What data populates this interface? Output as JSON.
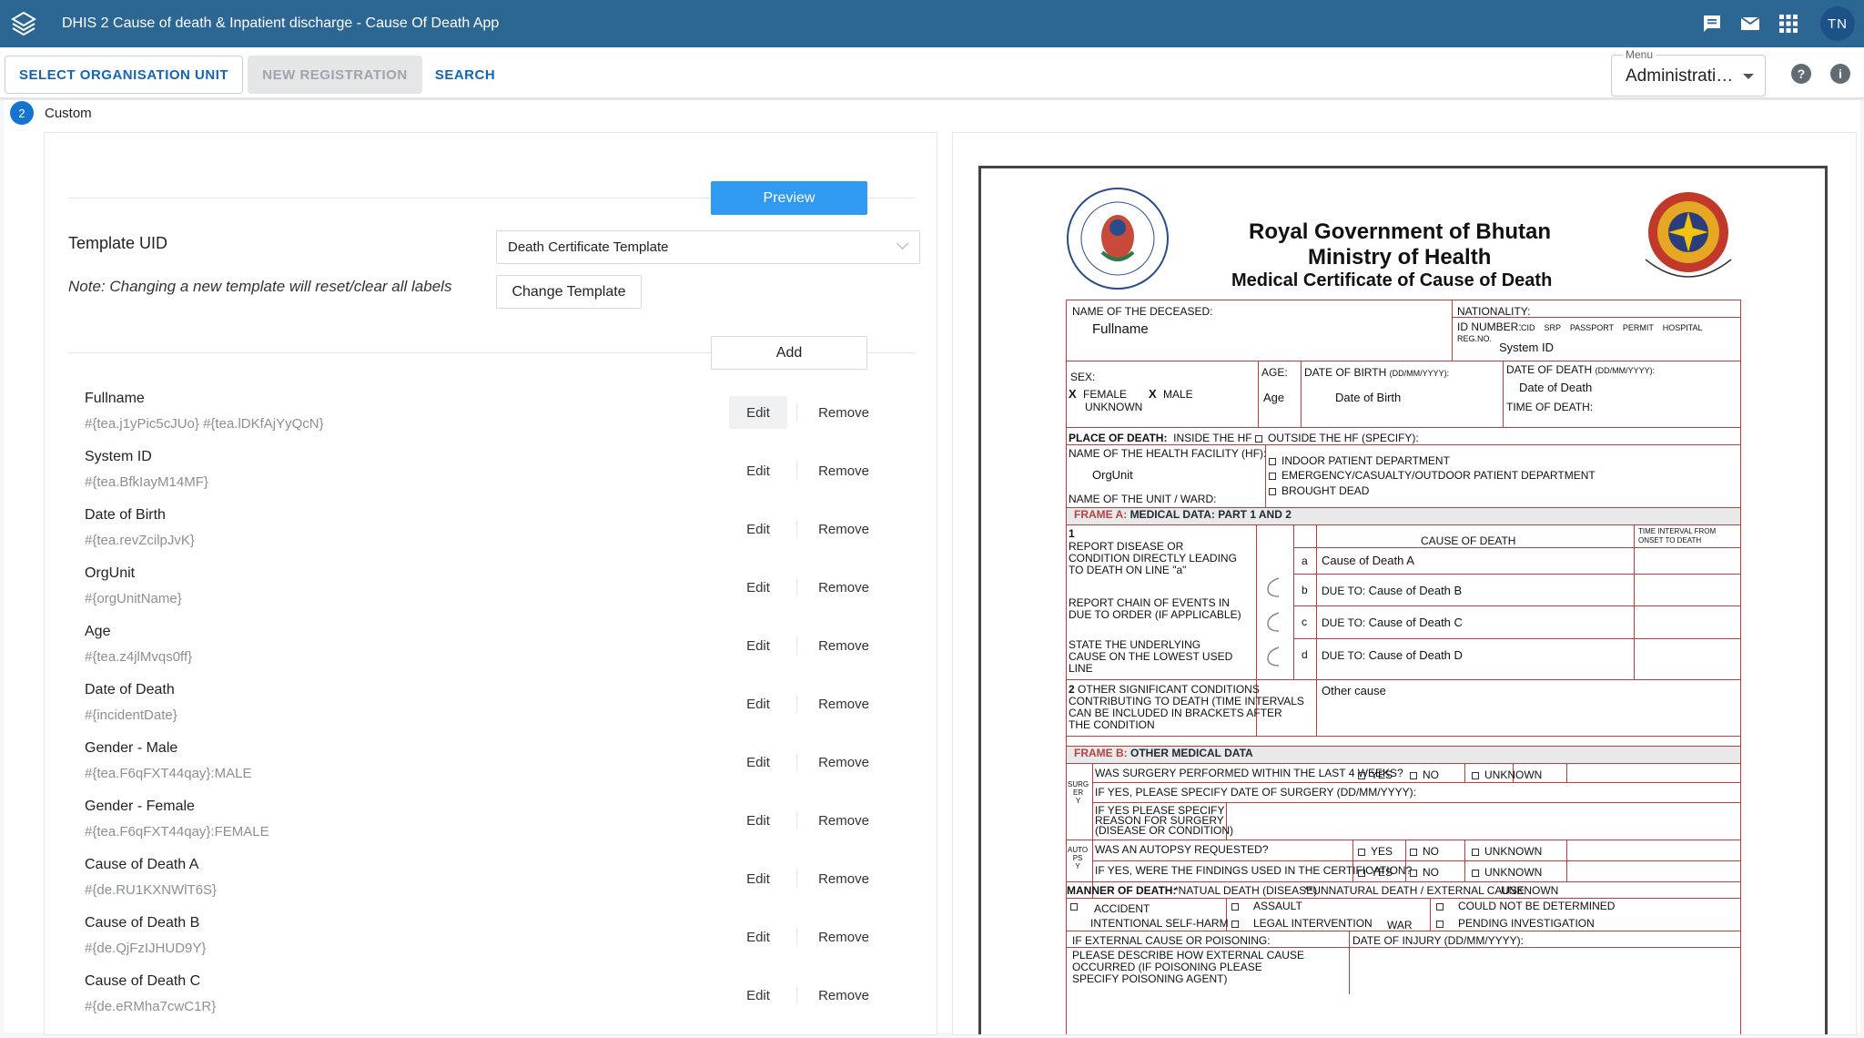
{
  "header": {
    "title": "DHIS 2 Cause of death & Inpatient discharge - Cause Of Death App",
    "profile_initials": "TN",
    "icons": [
      "app-logo-icon",
      "messages-icon",
      "email-icon",
      "apps-grid-icon"
    ]
  },
  "toolbar": {
    "select_org_unit": "SELECT ORGANISATION UNIT",
    "new_registration": "NEW REGISTRATION",
    "search": "SEARCH",
    "menu_label": "Menu",
    "menu_value": "Administrati…"
  },
  "step": {
    "number": "2",
    "label": "Custom"
  },
  "editor": {
    "preview_label": "Preview",
    "template_uid_label": "Template UID",
    "template_uid_value": "Death Certificate Template",
    "note": "Note: Changing a new template will reset/clear all labels",
    "change_template_label": "Change Template",
    "add_label": "Add",
    "edit_label": "Edit",
    "remove_label": "Remove",
    "items": [
      {
        "name": "Fullname",
        "code": "#{tea.j1yPic5cJUo} #{tea.lDKfAjYyQcN}"
      },
      {
        "name": "System ID",
        "code": "#{tea.BfkIayM14MF}"
      },
      {
        "name": "Date of Birth",
        "code": "#{tea.revZcilpJvK}"
      },
      {
        "name": "OrgUnit",
        "code": "#{orgUnitName}"
      },
      {
        "name": "Age",
        "code": "#{tea.z4jlMvqs0ff}"
      },
      {
        "name": "Date of Death",
        "code": "#{incidentDate}"
      },
      {
        "name": "Gender - Male",
        "code": "#{tea.F6qFXT44qay}:MALE"
      },
      {
        "name": "Gender - Female",
        "code": "#{tea.F6qFXT44qay}:FEMALE"
      },
      {
        "name": "Cause of Death A",
        "code": "#{de.RU1KXNWlT6S}"
      },
      {
        "name": "Cause of Death B",
        "code": "#{de.QjFzIJHUD9Y}"
      },
      {
        "name": "Cause of Death C",
        "code": "#{de.eRMha7cwC1R}"
      }
    ]
  },
  "certificate": {
    "title1": "Royal Government of Bhutan",
    "title2": "Ministry of Health",
    "title3": "Medical Certificate of Cause of Death",
    "name_of_deceased": "NAME OF THE DECEASED:",
    "fullname": "Fullname",
    "nationality": "NATIONALITY:",
    "id_number": "ID NUMBER:",
    "id_types": "CID    SRP    PASSPORT    PERMIT    HOSPITAL",
    "reg_no": "REG.NO.",
    "system_id": "System ID",
    "sex": "SEX:",
    "female": "FEMALE",
    "male": "MALE",
    "unknown": "UNKNOWN",
    "x_mark": "X",
    "age_label": "AGE:",
    "age": "Age",
    "dob_label": "DATE OF BIRTH",
    "dob_fmt": "(DD/MM/YYYY):",
    "dob": "Date of Birth",
    "dod_label": "DATE OF DEATH",
    "dod_fmt": "(DD/MM/YYYY):",
    "dod": "Date of Death",
    "time_of_death": "TIME OF DEATH:",
    "place_of_death": "PLACE OF DEATH:",
    "inside_hf": "INSIDE THE HF",
    "outside_hf": "OUTSIDE THE HF (SPECIFY):",
    "hf_name": "NAME OF THE HEALTH FACILITY (HF):",
    "orgunit": "OrgUnit",
    "unit_ward": "NAME OF THE UNIT / WARD:",
    "ipd": "INDOOR PATIENT DEPARTMENT",
    "emergency": "EMERGENCY/CASUALTY/OUTDOOR PATIENT DEPARTMENT",
    "brought_dead": "BROUGHT DEAD",
    "frame_a_prefix": "FRAME A:",
    "frame_a": "MEDICAL DATA: PART 1 AND 2",
    "part_1": "1",
    "report_disease": "REPORT DISEASE OR\nCONDITION DIRECTLY LEADING\nTO DEATH ON LINE \"a\"",
    "report_chain": "REPORT CHAIN OF EVENTS IN\nDUE TO ORDER (IF APPLICABLE)",
    "state_underlying": "STATE THE UNDERLYING\nCAUSE ON THE LOWEST USED\nLINE",
    "cause_of_death_hdr": "CAUSE OF DEATH",
    "time_interval": "TIME INTERVAL FROM\nONSET TO DEATH",
    "row_a": "a",
    "row_b": "b",
    "row_c": "c",
    "row_d": "d",
    "due_to": "DUE TO:",
    "cause_a": "Cause of Death A",
    "cause_b": "Cause of Death B",
    "cause_c": "Cause of Death C",
    "cause_d": "Cause of Death D",
    "part_2": "2",
    "other_significant": "OTHER SIGNIFICANT CONDITIONS\nCONTRIBUTING TO DEATH (TIME INTERVALS\nCAN BE INCLUDED IN BRACKETS AFTER\nTHE CONDITION",
    "other_cause": "Other cause",
    "frame_b_prefix": "FRAME B:",
    "frame_b": "OTHER MEDICAL DATA",
    "surgery_side": "SURG\nER\nY",
    "surgery_q": "WAS SURGERY PERFORMED WITHIN THE LAST 4 WEEKS?",
    "yes": "YES",
    "no": "NO",
    "unknown_opt": "UNKNOWN",
    "surgery_date": "IF YES, PLEASE SPECIFY DATE OF SURGERY (DD/MM/YYYY):",
    "surgery_reason": "IF YES PLEASE SPECIFY\nREASON FOR SURGERY\n(DISEASE OR CONDITION)",
    "autopsy_side": "AUTO\nPS\nY",
    "autopsy_q": "WAS AN AUTOPSY REQUESTED?",
    "findings_q": "IF YES, WERE THE FINDINGS USED IN THE CERTIFICATION?",
    "manner": "MANNER OF DEATH:",
    "natural": "*NATUAL DEATH (DISEASE)",
    "unnatural": "**UNNATURAL DEATH / EXTERNAL CAUSE",
    "manner_unknown": "UNKNOWN",
    "accident": "ACCIDENT",
    "assault": "ASSAULT",
    "not_determined": "COULD NOT BE DETERMINED",
    "self_harm": "INTENTIONAL SELF-HARM",
    "legal": "LEGAL INTERVENTION",
    "war": "WAR",
    "pending": "PENDING INVESTIGATION",
    "external_cause": "IF EXTERNAL CAUSE OR POISONING:",
    "injury_date": "DATE OF INJURY (DD/MM/YYYY):",
    "describe": "PLEASE DESCRIBE HOW EXTERNAL CAUSE\nOCCURRED (IF POISONING PLEASE\nSPECIFY POISONING AGENT)"
  },
  "colors": {
    "header_bg": "#2c6693",
    "accent": "#1465b8",
    "preview_btn": "#2f9af0",
    "frame_border": "#b24242"
  }
}
